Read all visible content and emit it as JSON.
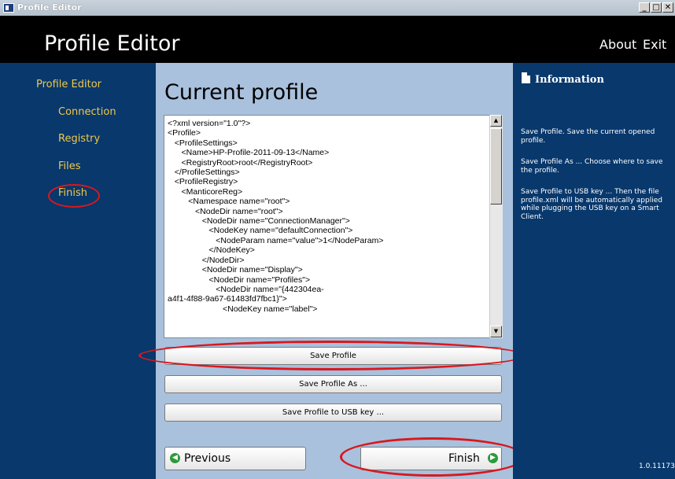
{
  "window": {
    "title": "Profile Editor",
    "buttons": [
      "_",
      "□",
      "✕"
    ]
  },
  "header": {
    "title": "Profile Editor",
    "about": "About",
    "exit": "Exit"
  },
  "nav": {
    "items": [
      {
        "label": "Profile Editor"
      },
      {
        "label": "Connection"
      },
      {
        "label": "Registry"
      },
      {
        "label": "Files"
      },
      {
        "label": "Finish"
      }
    ]
  },
  "main": {
    "title": "Current profile",
    "xml": "<?xml version=\"1.0\"?>\n<Profile>\n   <ProfileSettings>\n      <Name>HP-Profile-2011-09-13</Name>\n      <RegistryRoot>root</RegistryRoot>\n   </ProfileSettings>\n   <ProfileRegistry>\n      <ManticoreReg>\n         <Namespace name=\"root\">\n            <NodeDir name=\"root\">\n               <NodeDir name=\"ConnectionManager\">\n                  <NodeKey name=\"defaultConnection\">\n                     <NodeParam name=\"value\">1</NodeParam>\n                  </NodeKey>\n               </NodeDir>\n               <NodeDir name=\"Display\">\n                  <NodeDir name=\"Profiles\">\n                     <NodeDir name=\"{442304ea-\na4f1-4f88-9a67-61483fd7fbc1}\">\n                        <NodeKey name=\"label\">",
    "buttons": {
      "save": "Save Profile",
      "save_as": "Save Profile As ...",
      "save_usb": "Save Profile to USB key ..."
    },
    "previous": "Previous",
    "finish": "Finish"
  },
  "info": {
    "title": "Information",
    "paragraphs": [
      "Save Profile. Save the current opened profile.",
      "Save Profile As ... Choose where to save the profile.",
      "Save Profile to USB key ... Then the file profile.xml will be automatically applied while plugging the USB key on a Smart Client."
    ],
    "version": "1.0.11173"
  },
  "colors": {
    "highlight": "#d8181e",
    "nav_text": "#f1c84a",
    "panel_bg": "#a9c1dc",
    "sidebar_bg": "#08386c"
  }
}
